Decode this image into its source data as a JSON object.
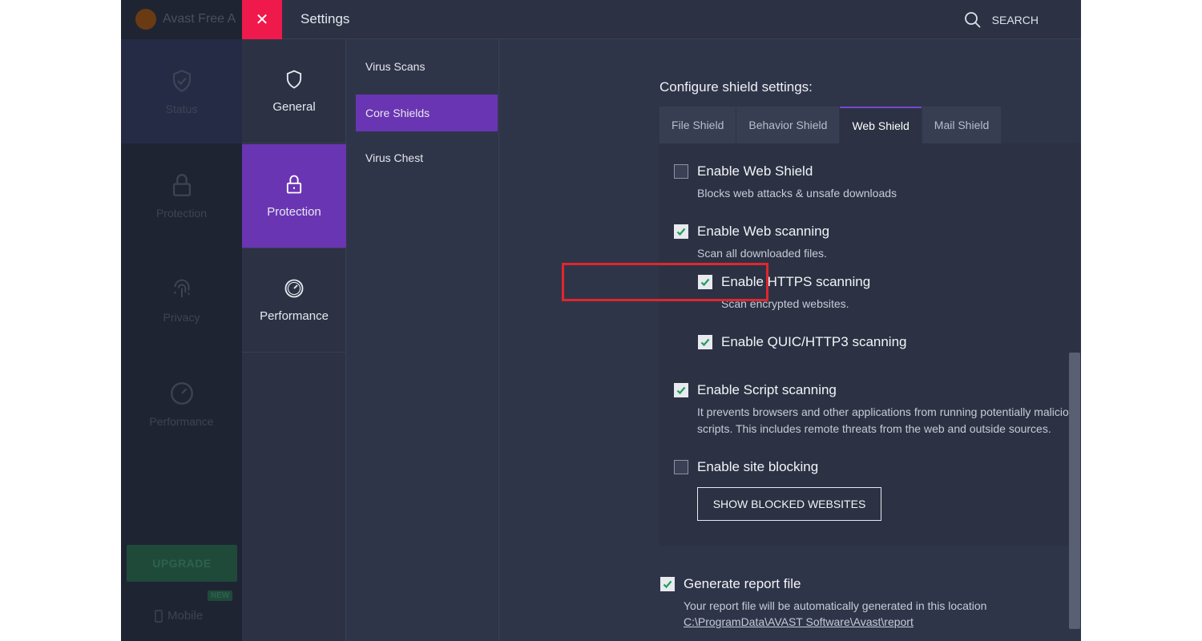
{
  "main": {
    "brand": "Avast Free A",
    "nav": [
      {
        "label": "Status",
        "icon": "shield-check-icon"
      },
      {
        "label": "Protection",
        "icon": "lock-icon"
      },
      {
        "label": "Privacy",
        "icon": "fingerprint-icon"
      },
      {
        "label": "Performance",
        "icon": "gauge-icon"
      }
    ],
    "upgrade_label": "UPGRADE",
    "new_badge": "NEW",
    "mobile_label": "Mobile"
  },
  "settings": {
    "close_glyph": "✕",
    "title": "Settings",
    "search_label": "SEARCH",
    "categories": [
      {
        "label": "General",
        "icon": "shield-icon"
      },
      {
        "label": "Protection",
        "icon": "lock-icon"
      },
      {
        "label": "Performance",
        "icon": "gauge-icon"
      }
    ],
    "subcategories": [
      "Virus Scans",
      "Core Shields",
      "Virus Chest"
    ],
    "section_title": "Configure shield settings:",
    "tabs": [
      "File Shield",
      "Behavior Shield",
      "Web Shield",
      "Mail Shield"
    ],
    "options": {
      "web_shield": {
        "label": "Enable Web Shield",
        "desc": "Blocks web attacks & unsafe downloads",
        "checked": false
      },
      "web_scanning": {
        "label": "Enable Web scanning",
        "desc": "Scan all downloaded files.",
        "checked": true
      },
      "https_scanning": {
        "label": "Enable HTTPS scanning",
        "desc": "Scan encrypted websites.",
        "checked": true
      },
      "quic_scanning": {
        "label": "Enable QUIC/HTTP3 scanning",
        "checked": true
      },
      "script_scanning": {
        "label": "Enable Script scanning",
        "desc_line1": "It prevents browsers and other applications from running potentially malicious",
        "desc_line2": "scripts. This includes remote threats from the web and outside sources.",
        "checked": true
      },
      "site_blocking": {
        "label": "Enable site blocking",
        "checked": false
      }
    },
    "blocked_button": "SHOW BLOCKED WEBSITES",
    "report": {
      "label": "Generate report file",
      "desc": "Your report file will be automatically generated in this location",
      "path": "C:\\ProgramData\\AVAST Software\\Avast\\report",
      "checked": true
    }
  },
  "colors": {
    "accent": "#6a35b3",
    "close": "#f0194b",
    "check": "#1e9e5a",
    "highlight": "#e0262e"
  }
}
